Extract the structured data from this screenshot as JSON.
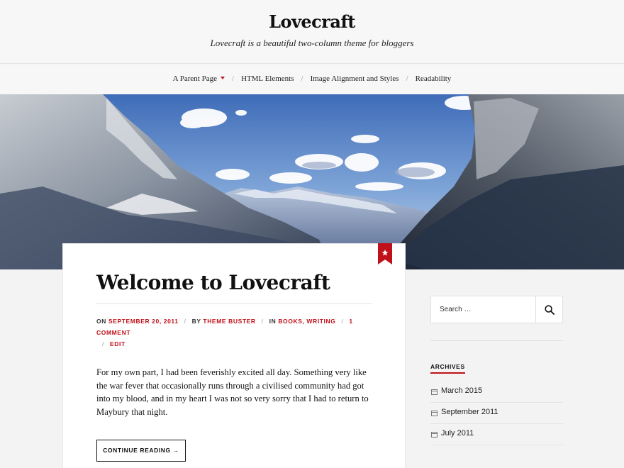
{
  "header": {
    "site_title": "Lovecraft",
    "site_description": "Lovecraft is a beautiful two-column theme for bloggers"
  },
  "nav": {
    "items": [
      {
        "label": "A Parent Page",
        "has_dropdown": true
      },
      {
        "label": "HTML Elements",
        "has_dropdown": false
      },
      {
        "label": "Image Alignment and Styles",
        "has_dropdown": false
      },
      {
        "label": "Readability",
        "has_dropdown": false
      }
    ],
    "separator": "/"
  },
  "hero": {
    "icon": "mountain-landscape-image"
  },
  "post": {
    "title": "Welcome to Lovecraft",
    "meta": {
      "on_label": "ON",
      "date": "SEPTEMBER 20, 2011",
      "by_label": "BY",
      "author": "THEME BUSTER",
      "in_label": "IN",
      "categories": [
        "BOOKS",
        "WRITING"
      ],
      "category_sep": ",",
      "comments": "1 COMMENT",
      "edit": "EDIT"
    },
    "excerpt": "For my own part, I had been feverishly excited all day. Something very like the war fever that occasionally runs through a civilised community had got into my blood, and in my heart I was not so very sorry that I had to return to Maybury that night.",
    "continue_label": "CONTINUE READING →",
    "sticky_icon": "star-bookmark-icon"
  },
  "sidebar": {
    "search_placeholder": "Search …",
    "archives_title": "ARCHIVES",
    "archives": [
      "March 2015",
      "September 2011",
      "July 2011"
    ]
  },
  "colors": {
    "accent": "#c0101a",
    "background": "#f3f3f3",
    "card": "#ffffff",
    "text": "#111111"
  }
}
